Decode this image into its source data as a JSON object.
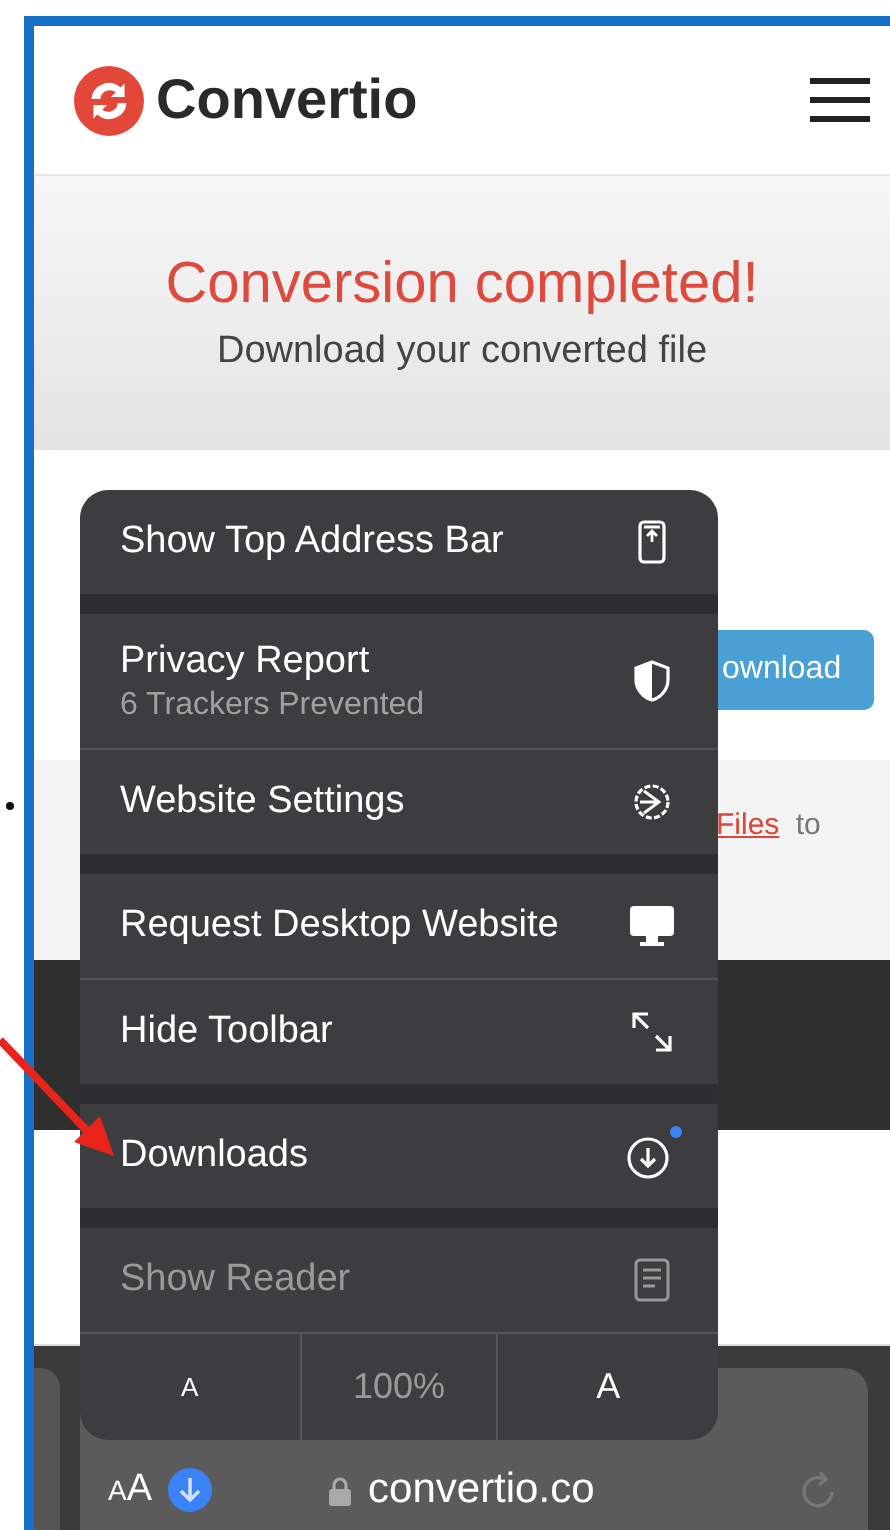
{
  "header": {
    "logo": "Convertio"
  },
  "hero": {
    "title": "Conversion completed!",
    "subtitle": "Download your converted file"
  },
  "download_button": {
    "label": "ownload"
  },
  "files_note": {
    "link": "Files",
    "text": "to"
  },
  "menu": {
    "groups": [
      [
        {
          "kind": "address-bar",
          "label": "Show Top Address Bar",
          "disabled": false,
          "notification": false
        }
      ],
      [
        {
          "kind": "privacy",
          "label": "Privacy Report",
          "subtitle": "6 Trackers Prevented",
          "disabled": false,
          "notification": false
        },
        {
          "kind": "settings",
          "label": "Website Settings",
          "disabled": false,
          "notification": false
        }
      ],
      [
        {
          "kind": "desktop",
          "label": "Request Desktop Website",
          "disabled": false,
          "notification": false
        },
        {
          "kind": "hide-toolbar",
          "label": "Hide Toolbar",
          "disabled": false,
          "notification": false
        }
      ],
      [
        {
          "kind": "downloads",
          "label": "Downloads",
          "disabled": false,
          "notification": true
        }
      ],
      [
        {
          "kind": "reader",
          "label": "Show Reader",
          "disabled": true,
          "notification": false
        }
      ]
    ],
    "zoom": {
      "decrease": "A",
      "level": "100%",
      "increase": "A"
    }
  },
  "address_bar": {
    "text_size_small": "A",
    "text_size_large": "A",
    "url": "convertio.co"
  }
}
